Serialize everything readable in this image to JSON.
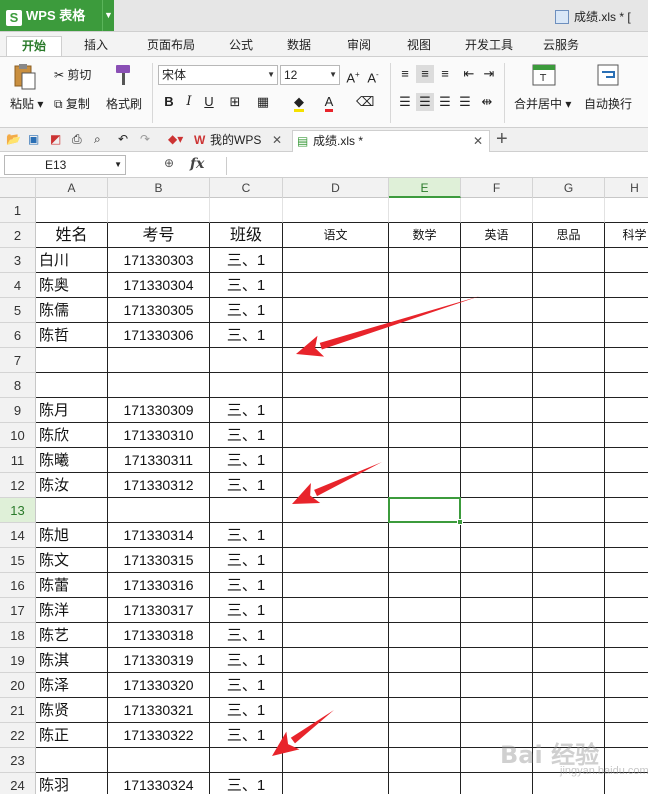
{
  "app": {
    "name": "WPS 表格",
    "logo_letter": "S",
    "doc_title": "成绩.xls * ["
  },
  "ribbon_tabs": [
    "开始",
    "插入",
    "页面布局",
    "公式",
    "数据",
    "审阅",
    "视图",
    "开发工具",
    "云服务"
  ],
  "active_ribbon_tab": 0,
  "ribbon": {
    "paste": "粘贴",
    "cut": "剪切",
    "copy": "复制",
    "format_painter": "格式刷",
    "font_name": "宋体",
    "font_size": "12",
    "bold": "B",
    "italic": "I",
    "underline": "U",
    "merge_center": "合并居中",
    "wrap_text": "自动换行"
  },
  "doc_tabs": [
    {
      "label": "我的WPS",
      "active": false
    },
    {
      "label": "成绩.xls *",
      "active": true
    }
  ],
  "new_tab": "+",
  "formula_bar": {
    "name_box": "E13",
    "fx": "fx",
    "formula": ""
  },
  "columns": [
    "A",
    "B",
    "C",
    "D",
    "E",
    "F",
    "G",
    "H"
  ],
  "selected_column": "E",
  "selected_row": "13",
  "rows": [
    {
      "n": "1",
      "cells": [
        "",
        "",
        "",
        "",
        "",
        "",
        "",
        ""
      ]
    },
    {
      "n": "2",
      "cells": [
        "姓名",
        "考号",
        "班级",
        "语文",
        "数学",
        "英语",
        "思品",
        "科学"
      ]
    },
    {
      "n": "3",
      "cells": [
        "白川",
        "171330303",
        "三、1",
        "",
        "",
        "",
        "",
        ""
      ]
    },
    {
      "n": "4",
      "cells": [
        "陈奥",
        "171330304",
        "三、1",
        "",
        "",
        "",
        "",
        ""
      ]
    },
    {
      "n": "5",
      "cells": [
        "陈儒",
        "171330305",
        "三、1",
        "",
        "",
        "",
        "",
        ""
      ]
    },
    {
      "n": "6",
      "cells": [
        "陈哲",
        "171330306",
        "三、1",
        "",
        "",
        "",
        "",
        ""
      ]
    },
    {
      "n": "7",
      "cells": [
        "",
        "",
        "",
        "",
        "",
        "",
        "",
        ""
      ]
    },
    {
      "n": "8",
      "cells": [
        "",
        "",
        "",
        "",
        "",
        "",
        "",
        ""
      ]
    },
    {
      "n": "9",
      "cells": [
        "陈月",
        "171330309",
        "三、1",
        "",
        "",
        "",
        "",
        ""
      ]
    },
    {
      "n": "10",
      "cells": [
        "陈欣",
        "171330310",
        "三、1",
        "",
        "",
        "",
        "",
        ""
      ]
    },
    {
      "n": "11",
      "cells": [
        "陈曦",
        "171330311",
        "三、1",
        "",
        "",
        "",
        "",
        ""
      ]
    },
    {
      "n": "12",
      "cells": [
        "陈汝",
        "171330312",
        "三、1",
        "",
        "",
        "",
        "",
        ""
      ]
    },
    {
      "n": "13",
      "cells": [
        "",
        "",
        "",
        "",
        "",
        "",
        "",
        ""
      ]
    },
    {
      "n": "14",
      "cells": [
        "陈旭",
        "171330314",
        "三、1",
        "",
        "",
        "",
        "",
        ""
      ]
    },
    {
      "n": "15",
      "cells": [
        "陈文",
        "171330315",
        "三、1",
        "",
        "",
        "",
        "",
        ""
      ]
    },
    {
      "n": "16",
      "cells": [
        "陈蕾",
        "171330316",
        "三、1",
        "",
        "",
        "",
        "",
        ""
      ]
    },
    {
      "n": "17",
      "cells": [
        "陈洋",
        "171330317",
        "三、1",
        "",
        "",
        "",
        "",
        ""
      ]
    },
    {
      "n": "18",
      "cells": [
        "陈艺",
        "171330318",
        "三、1",
        "",
        "",
        "",
        "",
        ""
      ]
    },
    {
      "n": "19",
      "cells": [
        "陈淇",
        "171330319",
        "三、1",
        "",
        "",
        "",
        "",
        ""
      ]
    },
    {
      "n": "20",
      "cells": [
        "陈泽",
        "171330320",
        "三、1",
        "",
        "",
        "",
        "",
        ""
      ]
    },
    {
      "n": "21",
      "cells": [
        "陈贤",
        "171330321",
        "三、1",
        "",
        "",
        "",
        "",
        ""
      ]
    },
    {
      "n": "22",
      "cells": [
        "陈正",
        "171330322",
        "三、1",
        "",
        "",
        "",
        "",
        ""
      ]
    },
    {
      "n": "23",
      "cells": [
        "",
        "",
        "",
        "",
        "",
        "",
        "",
        ""
      ]
    },
    {
      "n": "24",
      "cells": [
        "陈羽",
        "171330324",
        "三、1",
        "",
        "",
        "",
        "",
        ""
      ]
    }
  ],
  "watermark": {
    "text": "Bai 经验",
    "sub": "jingyan.baidu.com"
  },
  "colors": {
    "accent": "#3c9b3c",
    "arrow": "#e8242b",
    "grid_line": "#222222"
  }
}
